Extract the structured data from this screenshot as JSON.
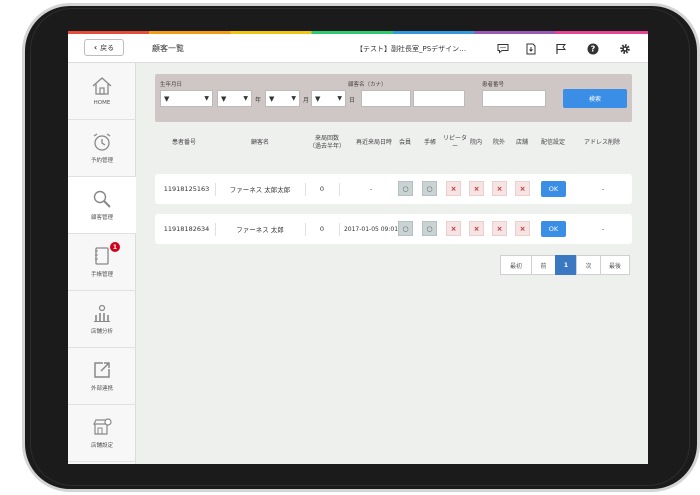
{
  "header": {
    "back_label": "戻る",
    "title": "顧客一覧",
    "shop": "【テスト】副社長室_PSデザイン…",
    "icons": [
      "chat-icon",
      "document-icon",
      "flag-icon",
      "help-icon",
      "gear-icon"
    ]
  },
  "sidebar": {
    "items": [
      {
        "label": "HOME",
        "icon": "home-icon"
      },
      {
        "label": "予約管理",
        "icon": "alarm-clock-icon"
      },
      {
        "label": "顧客管理",
        "icon": "magnifier-icon"
      },
      {
        "label": "手帳管理",
        "icon": "notebook-icon",
        "badge": "1"
      },
      {
        "label": "店舗分析",
        "icon": "analytics-icon"
      },
      {
        "label": "外部連携",
        "icon": "external-link-icon"
      },
      {
        "label": "店舗設定",
        "icon": "store-settings-icon"
      }
    ]
  },
  "search": {
    "birth_label": "生年月日",
    "name_label": "顧客名（カナ）",
    "patient_label": "患者番号",
    "year_unit": "年",
    "month_unit": "月",
    "day_unit": "日",
    "dropdown_value": "▼",
    "button": "検索"
  },
  "table": {
    "headers": [
      "患者番号",
      "顧客名",
      "来局回数\n（過去半年）",
      "再近来局日時",
      "会員",
      "手帳",
      "リピーター",
      "院内",
      "院外",
      "店舗",
      "配信設定",
      "アドレス削除"
    ],
    "rows": [
      {
        "id": "11918125163",
        "name": "ファーネス 太郎太郎",
        "visits": "0",
        "last_visit": "-",
        "member": "○",
        "techo": "○",
        "repeater": "×",
        "innai": "×",
        "ingai": "×",
        "store": "×",
        "delivery": "OK",
        "address_delete": "-"
      },
      {
        "id": "11918182634",
        "name": "ファーネス 太郎",
        "visits": "0",
        "last_visit": "2017-01-05 09:01",
        "member": "○",
        "techo": "○",
        "repeater": "×",
        "innai": "×",
        "ingai": "×",
        "store": "×",
        "delivery": "OK",
        "address_delete": "-"
      }
    ]
  },
  "pager": {
    "first": "最初",
    "prev": "前",
    "current": "1",
    "next": "次",
    "last": "最後"
  },
  "colors": {
    "primary_blue": "#3a8ee6",
    "panel": "#cfc6c6",
    "badge_red": "#d0021b",
    "content_bg": "#eef0ee"
  }
}
